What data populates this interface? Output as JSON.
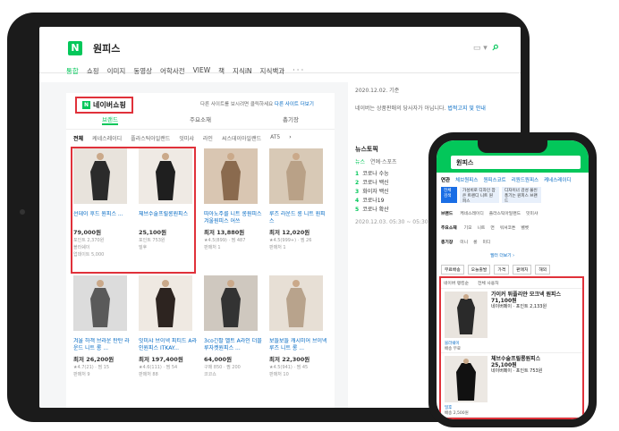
{
  "tablet": {
    "query": "원피스",
    "logo": "N",
    "tabs": [
      "통합",
      "쇼핑",
      "이미지",
      "동영상",
      "어학사전",
      "VIEW",
      "책",
      "지식iN",
      "지식백과",
      "· · ·"
    ],
    "shopping": {
      "title": "네이버쇼핑",
      "note": "다른 사이트를 보시려면 클릭하세요",
      "note_link": "다른 사이트 더보기",
      "subtabs": [
        "브랜드",
        "주요소재",
        "총기장"
      ],
      "brands": [
        "전체",
        "케네스레이디",
        "플라스틱아일랜드",
        "잇미샤",
        "라인",
        "씨스데이아일랜드",
        "AT5"
      ],
      "brand_more": "›",
      "products": [
        {
          "name": "선데이 후드 원피스 ...",
          "price": "79,000원",
          "meta": "포인트 2,370원",
          "seller": "블라쉐이",
          "extra": "업데이트 5,000"
        },
        {
          "name": "체브수술프릴롱원피스",
          "price": "25,100원",
          "meta": "포인트 753원",
          "seller": "밀후",
          "extra": ""
        },
        {
          "name": "따아노주를 니트 롱원피스 겨울원피스 어쓰",
          "price": "최저 13,880원",
          "meta": "★4.5(899) · 찜 487",
          "seller": "",
          "extra": "판매처 1"
        },
        {
          "name": "루즈 라운드 롱 니트 원피스",
          "price": "최저 12,020원",
          "meta": "★4.5(999+) · 찜 26",
          "seller": "",
          "extra": "판매처 1"
        },
        {
          "name": "겨울 하객 브라운 탄탄 라운드 니트 롱 ...",
          "price": "최저 26,200원",
          "meta": "★4.7(21) · 찜 15",
          "seller": "",
          "extra": "판매처 9"
        },
        {
          "name": "잇미샤 브이넥 피티드 A라인원피스 ITKAY...",
          "price": "최저 197,400원",
          "meta": "★4.6(111) · 찜 54",
          "seller": "",
          "extra": "판매처 88"
        },
        {
          "name": "3co긴팔 벨트 A라인 더블루자켓원피스 ...",
          "price": "64,000원",
          "meta": "구매 850 · 찜 200",
          "seller": "",
          "extra": "코코쇼"
        },
        {
          "name": "보들보들 캐시미어 브이넥 루즈 니트 롱 ...",
          "price": "최저 22,300원",
          "meta": "★4.5(941) · 찜 45",
          "seller": "",
          "extra": "판매처 10"
        }
      ]
    },
    "right": {
      "date": "2020.12.02. 기준",
      "notice": "네이버는 상품판매의 당사자가 아닙니다.",
      "notice_link": "법적고지 및 안내",
      "news_title": "뉴스토픽",
      "news_tabs": [
        "뉴스",
        "연예·스포츠"
      ],
      "news": [
        "코로나 수능",
        "코로나 백신",
        "화이자 백신",
        "코로나19",
        "코로나 확산"
      ],
      "timestamp": "2020.12.03. 05:30 ~ 05:30 기준"
    }
  },
  "phone": {
    "query": "원피스",
    "tabs": [
      "연관",
      "체브원피스",
      "원피스코트",
      "리원드원피스",
      "케네스레이디"
    ],
    "chips": [
      {
        "label": "전체 검색",
        "selected": true
      },
      {
        "label": "가성비로 디자인 잡은 트렌디 니트 원피스",
        "selected": false
      },
      {
        "label": "디자이너 감성 물씬 풍기는 원피스 브랜드",
        "selected": false
      }
    ],
    "filters": [
      {
        "label": "브랜드",
        "items": [
          "케네스레이디",
          "플라스틱아일랜드",
          "잇미샤"
        ]
      },
      {
        "label": "주요소재",
        "items": [
          "기모",
          "니트",
          "면",
          "워셔코튼",
          "벨벳"
        ]
      },
      {
        "label": "총기장",
        "items": [
          "미니",
          "롱",
          "미디"
        ]
      }
    ],
    "more": "필터 더보기 ›",
    "sort": [
      "무료배송",
      "오늘출발",
      "가격",
      "판매처",
      "해외"
    ],
    "list_head": [
      "네이버 랭킹순",
      "전체 사용처"
    ],
    "items": [
      {
        "name": "가이커 튀플리얀 모크넥 원피스",
        "price": "71,100원",
        "meta": "네이버페이 · 포인트 2,133원",
        "seller": "블라쉐이",
        "ship": "배송 무료"
      },
      {
        "name": "체브수술프릴롱원피스",
        "price": "25,100원",
        "meta": "네이버페이 · 포인트 753원",
        "seller": "밀후",
        "ship": "배송 2,500원"
      }
    ]
  }
}
